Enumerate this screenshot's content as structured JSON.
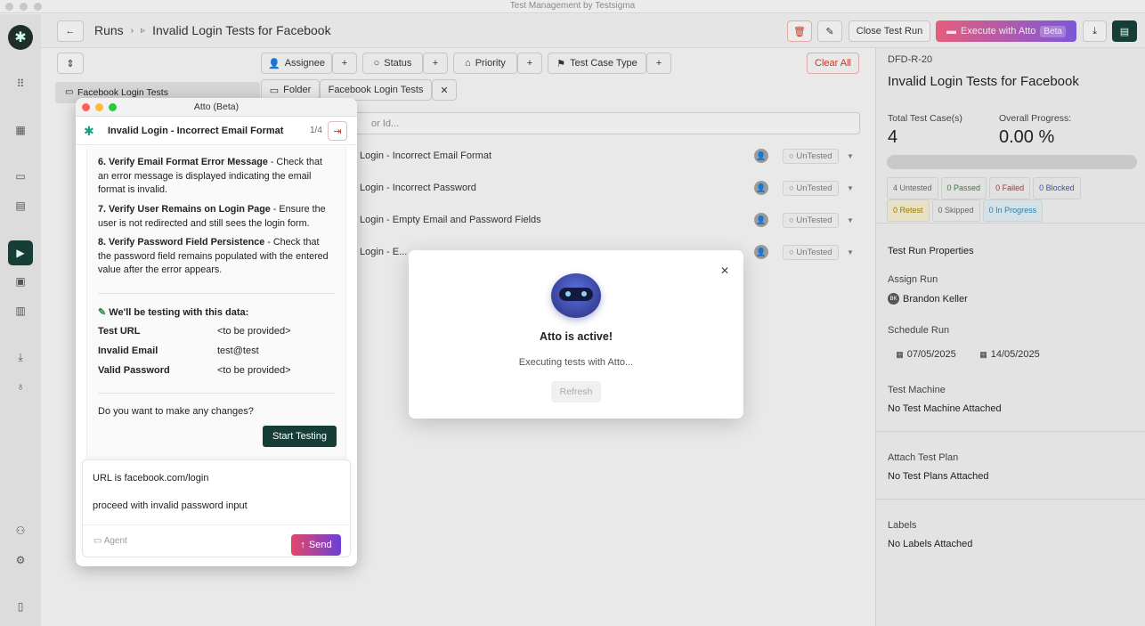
{
  "window": {
    "title": "Test Management by Testsigma"
  },
  "breadcrumb": {
    "root": "Runs",
    "current": "Invalid Login Tests for Facebook"
  },
  "toolbar": {
    "close_run": "Close Test Run",
    "execute": "Execute with Atto",
    "beta": "Beta"
  },
  "filters": {
    "assignee": "Assignee",
    "status": "Status",
    "priority": "Priority",
    "test_case_type": "Test Case Type",
    "clear_all": "Clear All",
    "folder": "Folder",
    "folder_value": "Facebook Login Tests",
    "search_placeholder": "or Id..."
  },
  "tree": {
    "folder": "Facebook Login Tests"
  },
  "rows": [
    {
      "name": "lid Login - Incorrect Email Format",
      "status": "UnTested"
    },
    {
      "name": "lid Login - Incorrect Password",
      "status": "UnTested"
    },
    {
      "name": "lid Login - Empty Email and Password Fields",
      "status": "UnTested"
    },
    {
      "name": "lid Login - E...",
      "status": "UnTested"
    }
  ],
  "details": {
    "id": "DFD-R-20",
    "title": "Invalid Login Tests for Facebook",
    "total_label": "Total Test Case(s)",
    "total_value": "4",
    "progress_label": "Overall Progress:",
    "progress_value": "0.00 %",
    "progress_fraction": 0,
    "counts": {
      "untested": "4 Untested",
      "passed": "0 Passed",
      "failed": "0 Failed",
      "blocked": "0 Blocked",
      "retest": "0 Retest",
      "skipped": "0 Skipped",
      "in_progress": "0 In Progress"
    },
    "properties_title": "Test Run Properties",
    "assign_label": "Assign Run",
    "assignee_initials": "BK",
    "assignee": "Brandon Keller",
    "schedule_label": "Schedule Run",
    "start_date": "07/05/2025",
    "end_date": "14/05/2025",
    "machine_label": "Test Machine",
    "machine_value": "No Test Machine Attached",
    "plan_label": "Attach Test Plan",
    "plan_value": "No Test Plans Attached",
    "labels_label": "Labels",
    "labels_value": "No Labels Attached"
  },
  "atto": {
    "window_title": "Atto (Beta)",
    "header_title": "Invalid Login - Incorrect Email Format",
    "pager": "1/4",
    "steps": [
      {
        "title": "6. Verify Email Format Error Message",
        "text": " - Check that an error message is displayed indicating the email format is invalid."
      },
      {
        "title": "7. Verify User Remains on Login Page",
        "text": " - Ensure the user is not redirected and still sees the login form."
      },
      {
        "title": "8. Verify Password Field Persistence",
        "text": " - Check that the password field remains populated with the entered value after the error appears."
      }
    ],
    "data_heading": "We'll be testing with this data:",
    "data": [
      {
        "key": "Test URL",
        "value": "<to be provided>"
      },
      {
        "key": "Invalid Email",
        "value": "test@test"
      },
      {
        "key": "Valid Password",
        "value": "<to be provided>"
      }
    ],
    "question": "Do you want to make any changes?",
    "start_button": "Start Testing",
    "input_line1": "URL is facebook.com/login",
    "input_line2": "proceed with invalid password input",
    "agent_label": "Agent",
    "send_button": "Send"
  },
  "modal": {
    "title": "Atto is active!",
    "message": "Executing tests with Atto...",
    "refresh": "Refresh"
  },
  "colors": {
    "accent_dark": "#163d36",
    "execute_gradient_start": "#e6466b",
    "execute_gradient_end": "#6b3fd6",
    "clear_red": "#c0392b"
  }
}
